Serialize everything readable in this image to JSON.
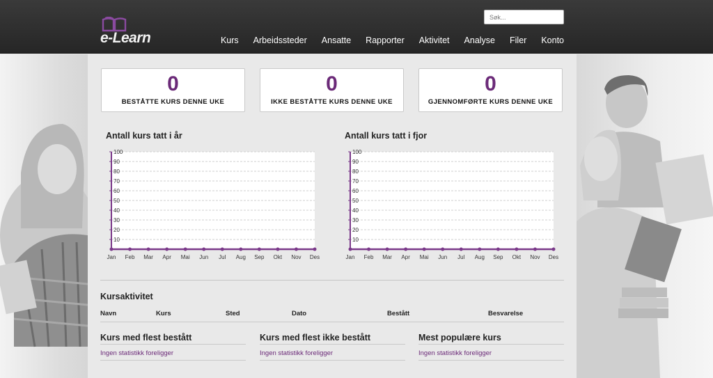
{
  "brand": {
    "name": "e-Learn",
    "accent": "#6b2a78"
  },
  "search": {
    "placeholder": "Søk..."
  },
  "nav": [
    "Kurs",
    "Arbeidssteder",
    "Ansatte",
    "Rapporter",
    "Aktivitet",
    "Analyse",
    "Filer",
    "Konto"
  ],
  "stats": [
    {
      "value": "0",
      "label": "BESTÅTTE KURS DENNE UKE"
    },
    {
      "value": "0",
      "label": "IKKE BESTÅTTE KURS DENNE UKE"
    },
    {
      "value": "0",
      "label": "GJENNOMFØRTE KURS DENNE UKE"
    }
  ],
  "chart_data": [
    {
      "type": "line",
      "title": "Antall kurs tatt i år",
      "categories": [
        "Jan",
        "Feb",
        "Mar",
        "Apr",
        "Mai",
        "Jun",
        "Jul",
        "Aug",
        "Sep",
        "Okt",
        "Nov",
        "Des"
      ],
      "series": [
        {
          "values": [
            0,
            0,
            0,
            0,
            0,
            0,
            0,
            0,
            0,
            0,
            0,
            0
          ],
          "color": "#7b3a8a"
        }
      ],
      "yticks": [
        10,
        20,
        30,
        40,
        50,
        60,
        70,
        80,
        90,
        100
      ],
      "ylim": [
        0,
        100
      ],
      "grid": true
    },
    {
      "type": "line",
      "title": "Antall kurs tatt i fjor",
      "categories": [
        "Jan",
        "Feb",
        "Mar",
        "Apr",
        "Mai",
        "Jun",
        "Jul",
        "Aug",
        "Sep",
        "Okt",
        "Nov",
        "Des"
      ],
      "series": [
        {
          "values": [
            0,
            0,
            0,
            0,
            0,
            0,
            0,
            0,
            0,
            0,
            0,
            0
          ],
          "color": "#7b3a8a"
        }
      ],
      "yticks": [
        10,
        20,
        30,
        40,
        50,
        60,
        70,
        80,
        90,
        100
      ],
      "ylim": [
        0,
        100
      ],
      "grid": true
    }
  ],
  "activity": {
    "title": "Kursaktivitet",
    "columns": [
      "Navn",
      "Kurs",
      "Sted",
      "Dato",
      "Bestått",
      "Besvarelse"
    ]
  },
  "bottom": [
    {
      "title": "Kurs med flest bestått",
      "empty": "Ingen statistikk foreligger"
    },
    {
      "title": "Kurs med flest ikke bestått",
      "empty": "Ingen statistikk foreligger"
    },
    {
      "title": "Mest populære kurs",
      "empty": "Ingen statistikk foreligger"
    }
  ]
}
